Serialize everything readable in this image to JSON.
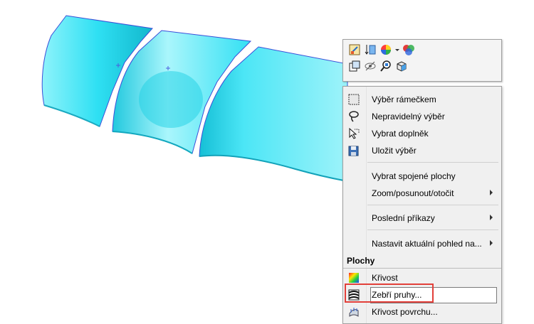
{
  "menu": {
    "items": [
      {
        "id": "box-select",
        "label": "Výběr rámečkem",
        "icon": "box-select-icon"
      },
      {
        "id": "lasso-select",
        "label": "Nepravidelný výběr",
        "icon": "lasso-icon"
      },
      {
        "id": "select-other",
        "label": "Vybrat doplněk",
        "icon": "select-cursor-icon"
      },
      {
        "id": "save-selection",
        "label": "Uložit výběr",
        "icon": "save-selection-icon"
      },
      {
        "id": "select-tangency",
        "label": "Vybrat spojené plochy"
      },
      {
        "id": "zoom-pan-rotate",
        "label": "Zoom/posunout/otočit",
        "submenu": true
      },
      {
        "id": "recent-commands",
        "label": "Poslední příkazy",
        "submenu": true
      },
      {
        "id": "set-current-view",
        "label": "Nastavit aktuální pohled na...",
        "submenu": true
      }
    ],
    "section_title": "Plochy",
    "section_items": [
      {
        "id": "curvature",
        "label": "Křivost",
        "icon": "curvature-icon"
      },
      {
        "id": "zebra-stripes",
        "label": "Zebří pruhy...",
        "icon": "zebra-stripes-icon"
      },
      {
        "id": "surface-curvature",
        "label": "Křivost povrchu...",
        "icon": "surface-curvature-icon"
      }
    ]
  },
  "toolbar": {
    "row1": [
      "edit-sketch-icon",
      "normal-to-icon",
      "appearance-icon",
      "dropdown-icon",
      "display-style-icon"
    ],
    "row2": [
      "hide-show-icon",
      "hide-icon",
      "zoom-to-selection-icon",
      "view-orientation-icon"
    ]
  },
  "colors": {
    "surface": "#33e0f5",
    "highlight_border": "#e2403a"
  }
}
